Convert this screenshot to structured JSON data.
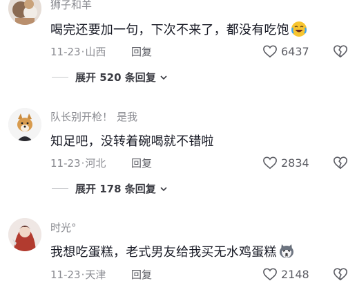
{
  "comments": [
    {
      "username": "狮子和羊",
      "text": "喝完还要加一句，下次不来了，都没有吃饱",
      "emoji": "crying-laughing-emoji",
      "date": "11-23",
      "location": "山西",
      "reply_label": "回复",
      "like_count": "6437",
      "expand_label": "展开 520 条回复"
    },
    {
      "username": "队长别开枪！",
      "self_tag": "是我",
      "text": "知足吧，没转着碗喝就不错啦",
      "date": "11-23",
      "location": "河北",
      "reply_label": "回复",
      "like_count": "2834",
      "expand_label": "展开 178 条回复"
    },
    {
      "username": "时光°",
      "text": "我想吃蛋糕，老式男友给我买无水鸡蛋糕",
      "emoji": "husky-emoji",
      "date": "11-23",
      "location": "天津",
      "reply_label": "回复",
      "like_count": "2148"
    }
  ],
  "separator": "·",
  "colors": {
    "text_primary": "#161823",
    "text_secondary": "#8a8b91",
    "icon": "#5b5c63"
  }
}
